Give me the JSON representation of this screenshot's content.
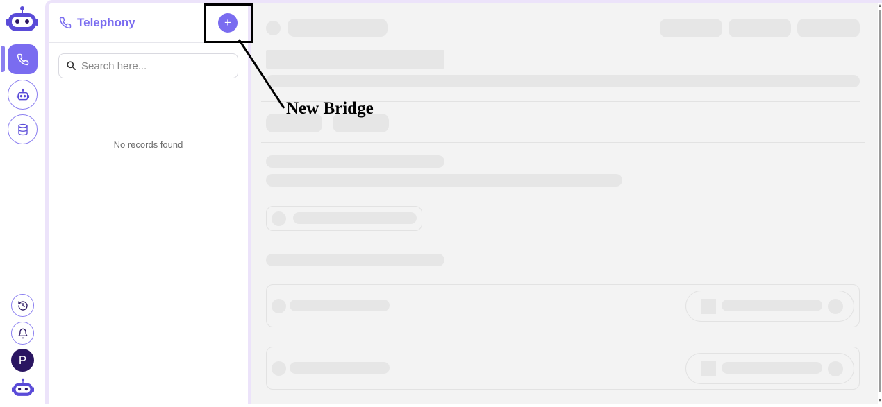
{
  "sidebar": {
    "title": "Telephony",
    "add_label": "+",
    "search_placeholder": "Search here...",
    "empty_text": "No records found"
  },
  "rail": {
    "avatar_initial": "P",
    "items": [
      "phone-icon",
      "bot-icon",
      "database-icon"
    ],
    "bottom": [
      "history-icon",
      "bell-icon"
    ]
  },
  "annotation": {
    "label": "New Bridge"
  },
  "colors": {
    "accent": "#7a6cf0",
    "avatar_bg": "#2a1561",
    "skeleton": "#e6e6e6"
  }
}
